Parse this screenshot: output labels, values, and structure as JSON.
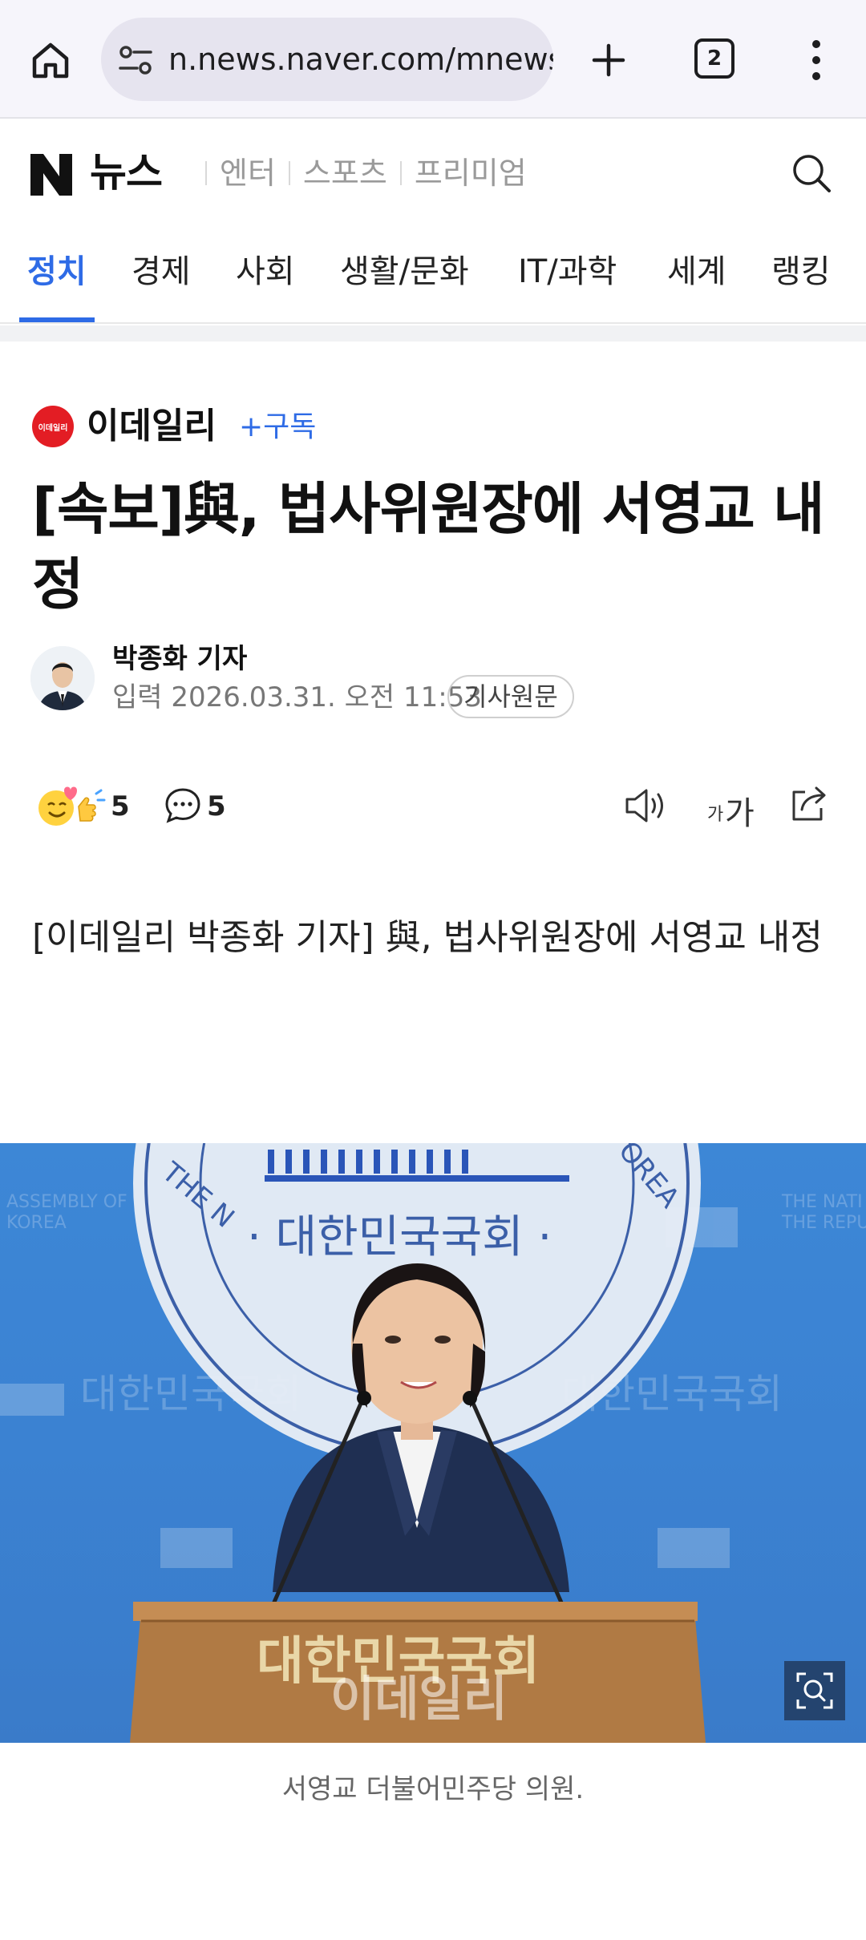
{
  "browser": {
    "url": "n.news.naver.com/mnews/article",
    "tab_count": "2"
  },
  "header": {
    "news_label": "뉴스",
    "links": [
      "엔터",
      "스포츠",
      "프리미엄"
    ]
  },
  "categories": [
    "정치",
    "경제",
    "사회",
    "생활/문화",
    "IT/과학",
    "세계",
    "랭킹"
  ],
  "press": {
    "name": "이데일리",
    "logo_text": "이데일리",
    "subscribe": "+구독"
  },
  "article": {
    "headline": "[속보]與, 법사위원장에 서영교 내정",
    "reporter": "박종화 기자",
    "date": "입력 2026.03.31. 오전 11:53",
    "original_button": "기사원문",
    "body": "[이데일리 박종화 기자] 與, 법사위원장에 서영교 내정"
  },
  "reactions": {
    "like_count": "5",
    "comment_count": "5",
    "font_small": "가",
    "font_big": "가"
  },
  "photo": {
    "seal_text": "· 대한민국국회 ·",
    "seal_ring_left": "THE N",
    "seal_ring_right": "OREA",
    "wall_text_left": "대한민국국회",
    "wall_text_right": "대한민국국회",
    "wall_en_left_1": "ASSEMBLY OF",
    "wall_en_left_2": "KOREA",
    "wall_en_right_1": "THE NATI",
    "wall_en_right_2": "THE REPU",
    "podium_text": "대한민국국회",
    "watermark": "이데일리",
    "caption": "서영교 더불어민주당 의원."
  }
}
